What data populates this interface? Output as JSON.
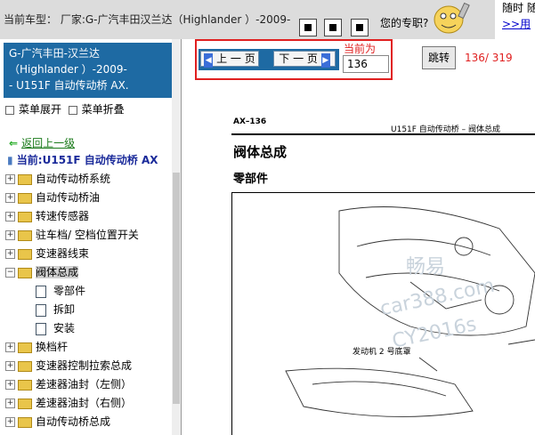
{
  "topbar": {
    "car_model": "当前车型： 厂家:G-广汽丰田汉兰达（Highlander ）-2009-",
    "favorites": "您的专职?",
    "promo_line1": "随时 随",
    "promo_link": ">>用"
  },
  "sidebar": {
    "title_lines": [
      "G-广汽丰田-汉兰达",
      "（Highlander ）-2009-",
      "- U151F 自动传动桥 AX."
    ],
    "expand_label": "菜单展开",
    "collapse_label": "菜单折叠",
    "back_label": "返回上一级",
    "current_label": "当前:U151F 自动传动桥 AX",
    "tree_items": [
      {
        "label": "自动传动桥系统",
        "expanded": false
      },
      {
        "label": "自动传动桥油",
        "expanded": false
      },
      {
        "label": "转速传感器",
        "expanded": false
      },
      {
        "label": "驻车档/ 空档位置开关",
        "expanded": false
      },
      {
        "label": "变速器线束",
        "expanded": false
      },
      {
        "label": "阀体总成",
        "expanded": true
      },
      {
        "label": "换档杆",
        "expanded": false
      },
      {
        "label": "变速器控制拉索总成",
        "expanded": false
      },
      {
        "label": "差速器油封（左侧）",
        "expanded": false
      },
      {
        "label": "差速器油封（右侧）",
        "expanded": false
      },
      {
        "label": "自动传动桥总成",
        "expanded": false
      }
    ],
    "sub_items": [
      "零部件",
      "拆卸",
      "安装"
    ]
  },
  "nav": {
    "prev_label": "上 一 页",
    "next_label": "下 一 页",
    "current_label": "当前为",
    "page_value": "136",
    "jump_label": "跳转",
    "page_count": "136/ 319"
  },
  "document": {
    "code": "AX–136",
    "header_right": "U151F 自动传动桥 – 阀体总成",
    "title": "阀体总成",
    "subtitle": "零部件",
    "diagram_label": "发动机 2 号底罩",
    "watermark_lines": [
      "畅易",
      "car388.com",
      "CY2016s"
    ]
  },
  "colors": {
    "accent_blue": "#1e6aa3",
    "highlight_red": "#e02020",
    "link_green": "#1a7a1a"
  }
}
